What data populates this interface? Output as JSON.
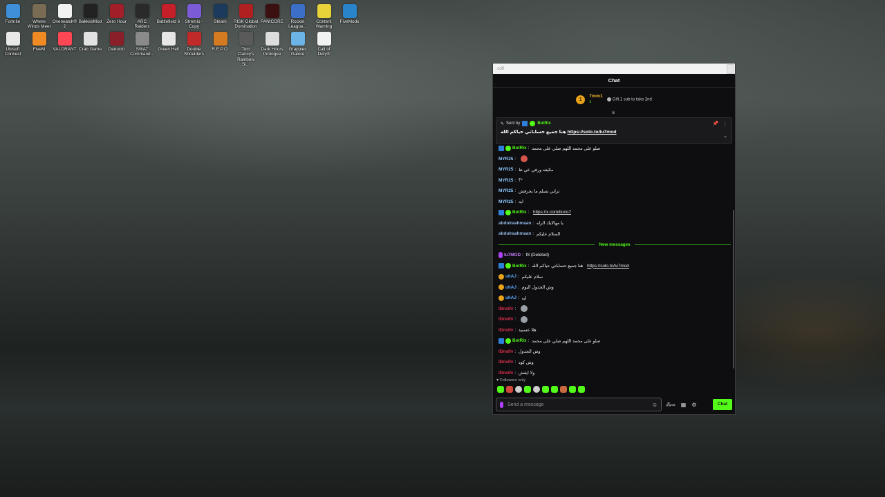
{
  "desktop": {
    "icons": [
      {
        "label": "Fortnite",
        "color": "#3f8fd8"
      },
      {
        "label": "Where Winds Meet",
        "color": "#7a6b55"
      },
      {
        "label": "Overwatch® 2",
        "color": "#f2f2f2"
      },
      {
        "label": "BakkesMod",
        "color": "#222222"
      },
      {
        "label": "Zero Hour",
        "color": "#a21f2a"
      },
      {
        "label": "ARC Raiders",
        "color": "#2a2a2a"
      },
      {
        "label": "Battlefield 6",
        "color": "#c5202a"
      },
      {
        "label": "Stremio - Copy",
        "color": "#7b5bd6"
      },
      {
        "label": "Steam",
        "color": "#1b3a5c"
      },
      {
        "label": "RISK Global Domination",
        "color": "#b02020"
      },
      {
        "label": "PANICORE",
        "color": "#3a1010"
      },
      {
        "label": "Rocket League...",
        "color": "#3c70c8"
      },
      {
        "label": "Content Warning",
        "color": "#e8d23a"
      },
      {
        "label": "FiveMods",
        "color": "#2a84c9"
      },
      {
        "label": "Ubisoft Connect",
        "color": "#e8e8e8"
      },
      {
        "label": "FiveM",
        "color": "#f08a24"
      },
      {
        "label": "VALORANT",
        "color": "#ff4655"
      },
      {
        "label": "Crab Game",
        "color": "#e2e2e2"
      },
      {
        "label": "Deducto",
        "color": "#8a1f2a"
      },
      {
        "label": "SWAT Command...",
        "color": "#8a8a8a"
      },
      {
        "label": "Green Hell",
        "color": "#e6e6e6"
      },
      {
        "label": "Double Shoulders",
        "color": "#c22a2a"
      },
      {
        "label": "R.E.P.O.",
        "color": "#d47a20"
      },
      {
        "label": "Tom Clancy's Rainbow Si...",
        "color": "#5a5a5a"
      },
      {
        "label": "Dark Hours Prologue",
        "color": "#dddddd"
      },
      {
        "label": "Grapples Galore",
        "color": "#6cb4e6"
      },
      {
        "label": "Call of Duty®",
        "color": "#f2f2f2"
      }
    ]
  },
  "window": {
    "title": "cdlf",
    "chat_header": "Chat",
    "top_gifter": {
      "name": "7mm1",
      "count": "1",
      "rank": "1"
    },
    "gift_text": "Gift 1 sub to take 2nd",
    "pinned": {
      "sent_by_label": "Sent by",
      "author": "BotRix",
      "message": "هنا جميع حساباتي حياكم الله",
      "link": "https://solo.to/lu7mod"
    },
    "messages": [
      {
        "user": "BotRix",
        "type": "bot",
        "text": "صلو على محمد اللهم صلي على محمد"
      },
      {
        "user": "MYR25",
        "type": "myr",
        "text": "",
        "emote": "red"
      },
      {
        "user": "MYR25",
        "type": "myr",
        "text": "مكيفه ورفي عي ط"
      },
      {
        "user": "MYR25",
        "type": "myr",
        "text": "؟*"
      },
      {
        "user": "MYR25",
        "type": "myr",
        "text": "ترابي تسلم ما يحرقش"
      },
      {
        "user": "MYR25",
        "type": "myr",
        "text": "ايه"
      },
      {
        "user": "BotRix",
        "type": "bot",
        "text": "",
        "link": "https://x.com/lluno7"
      },
      {
        "user": "abdulraahmaan",
        "type": "abd",
        "text": "يا مهالايك الرله"
      },
      {
        "user": "abdulraahmaan",
        "type": "abd",
        "text": "السلام عليكم"
      }
    ],
    "new_messages_label": "New messages",
    "new_messages": [
      {
        "user": "lu7MOD",
        "type": "lu",
        "text": "f8 (Deleted)"
      },
      {
        "user": "BotRix",
        "type": "bot",
        "text": "هنا جميع حساباتي حياكم الله",
        "link": "https://solo.to/lu7mod"
      },
      {
        "user": "uhAJ",
        "type": "uha",
        "text": "سلام عليكم"
      },
      {
        "user": "uhAJ",
        "type": "uha",
        "text": "وش الجدول اليوم"
      },
      {
        "user": "uhAJ",
        "type": "uha",
        "text": "ايه"
      },
      {
        "user": "lDnsifv",
        "type": "red",
        "text": "",
        "emote": "grey"
      },
      {
        "user": "lDnsifv",
        "type": "red",
        "text": "",
        "emote": "grey"
      },
      {
        "user": "lDnsifv",
        "type": "red",
        "text": "هلا عسبيد"
      },
      {
        "user": "BotRix",
        "type": "bot",
        "text": "صلو على محمد اللهم صلي على محمد"
      },
      {
        "user": "lDnsifv",
        "type": "red",
        "text": "وش الجدول"
      },
      {
        "user": "lDnsifv",
        "type": "red",
        "text": "وش كود"
      },
      {
        "user": "lDnsifv",
        "type": "red",
        "text": "ولا ايقش"
      }
    ],
    "followers_only": "Followers only",
    "input_placeholder": "Send a message",
    "send_button": "Chat",
    "colors": {
      "accent": "#53fc18",
      "background": "#0e0e10"
    }
  }
}
